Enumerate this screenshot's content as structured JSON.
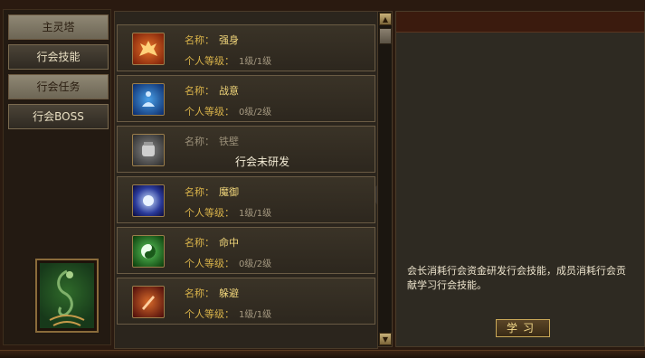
{
  "nav": {
    "items": [
      {
        "label": "主灵塔"
      },
      {
        "label": "行会技能"
      },
      {
        "label": "行会任务"
      },
      {
        "label": "行会BOSS"
      }
    ]
  },
  "skills": [
    {
      "name_label": "名称：",
      "name": "强身",
      "level_label": "个人等级：",
      "level": "1级/1级",
      "icon": "strength-icon"
    },
    {
      "name_label": "名称：",
      "name": "战意",
      "level_label": "个人等级：",
      "level": "0级/2级",
      "icon": "meditation-icon"
    },
    {
      "name_label": "名称：",
      "name": "铁壁",
      "status": "行会未研发",
      "icon": "iron-fist-icon"
    },
    {
      "name_label": "名称：",
      "name": "魔御",
      "level_label": "个人等级：",
      "level": "1级/1级",
      "icon": "magic-orb-icon"
    },
    {
      "name_label": "名称：",
      "name": "命中",
      "level_label": "个人等级：",
      "level": "0级/2级",
      "icon": "accuracy-swirl-icon"
    },
    {
      "name_label": "名称：",
      "name": "躲避",
      "level_label": "个人等级：",
      "level": "1级/1级",
      "icon": "evade-blade-icon"
    }
  ],
  "detail": {
    "description": "会长消耗行会资金研发行会技能，成员消耗行会贡献学习行会技能。",
    "learn_label": "学习"
  },
  "colors": {
    "gold": "#d8b24a",
    "panel": "#2e2a22"
  }
}
